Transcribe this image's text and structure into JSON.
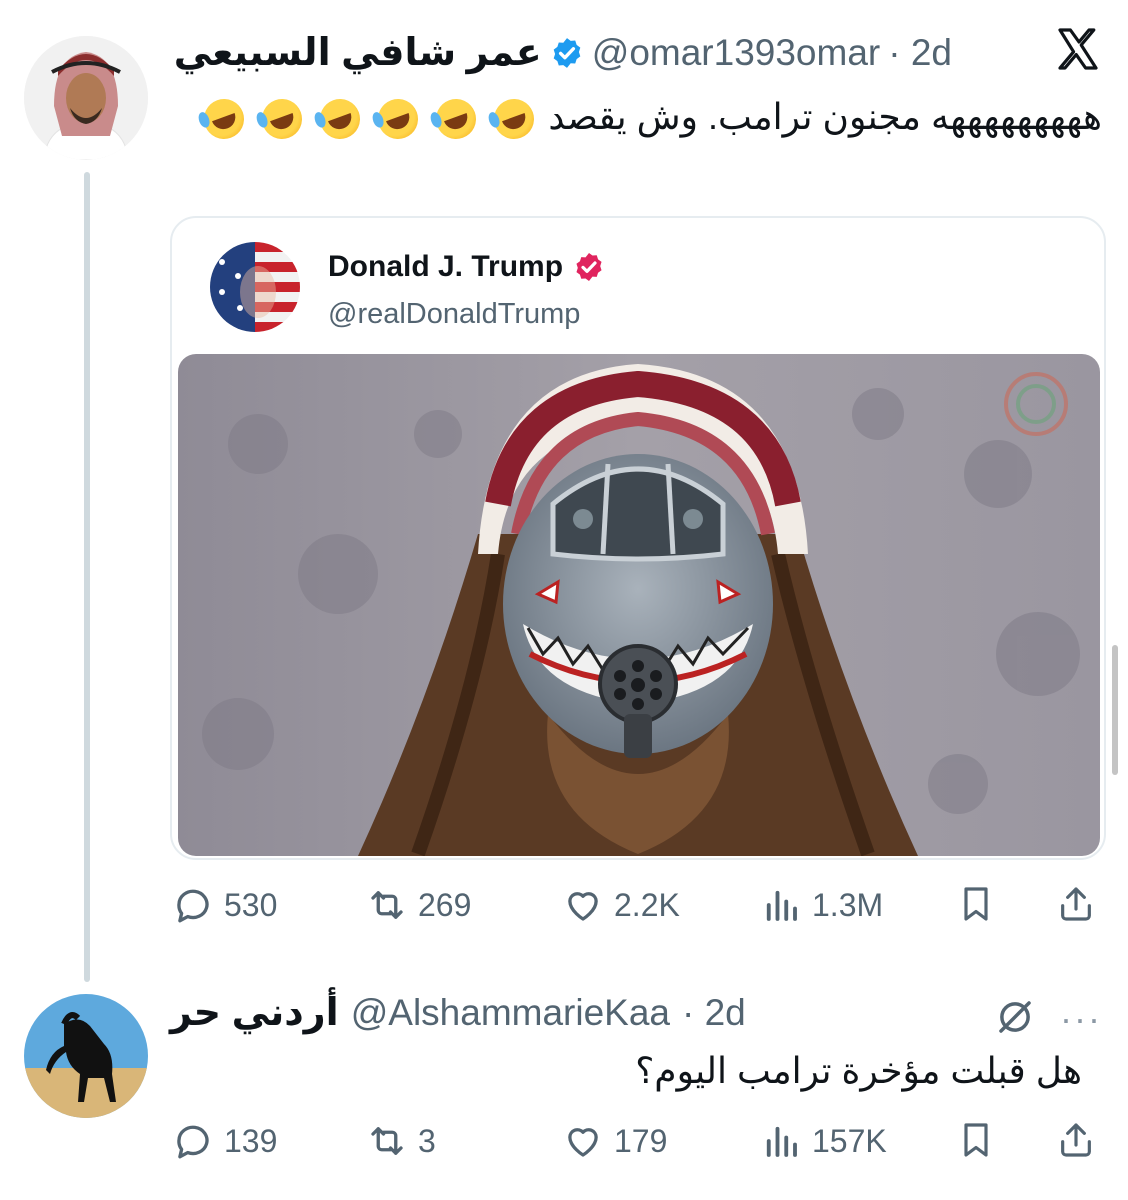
{
  "post1": {
    "author_name": "عمر شافي السبيعي",
    "handle": "@omar1393omar",
    "time": "· 2d",
    "text": "هههههههههه مجنون ترامب. وش يقصد",
    "emoji_icon": "rolling-on-floor-laughing-emoji",
    "x_logo": "𝕏",
    "quote": {
      "author_name": "Donald J. Trump",
      "handle": "@realDonaldTrump",
      "image_alt_icon": "fighter-jet-face-meme-image"
    },
    "metrics": {
      "replies": "530",
      "reposts": "269",
      "likes": "2.2K",
      "views": "1.3M"
    }
  },
  "post2": {
    "author_name": "أردني حر",
    "handle": "@AlshammarieKaa",
    "time": "· 2d",
    "text": "هل قبلت مؤخرة ترامب اليوم؟",
    "more": "···",
    "metrics": {
      "replies": "139",
      "reposts": "3",
      "likes": "179",
      "views": "157K"
    }
  },
  "colors": {
    "verified_blue": "#1d9bf0",
    "verified_pink": "#e0245e",
    "muted": "#536471",
    "thread_line": "#cfd9de"
  }
}
